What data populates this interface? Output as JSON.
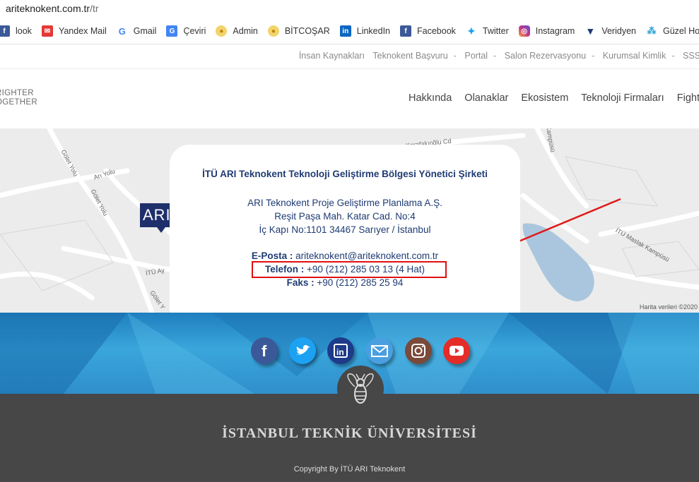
{
  "browser": {
    "url_host": "ariteknokent.com.tr",
    "url_path": "/tr",
    "bookmarks": [
      {
        "label": "look",
        "icon": "facebook-icon",
        "color": "#3b5998"
      },
      {
        "label": "Yandex Mail",
        "icon": "yandex-mail-icon",
        "color": "#e53935"
      },
      {
        "label": "Gmail",
        "icon": "google-icon",
        "color": "#4285f4"
      },
      {
        "label": "Çeviri",
        "icon": "translate-icon",
        "color": "#4285f4"
      },
      {
        "label": "Admin",
        "icon": "coin-icon",
        "color": "#e8c34a"
      },
      {
        "label": "BİTCOŞAR",
        "icon": "coin-icon",
        "color": "#e8c34a"
      },
      {
        "label": "LinkedIn",
        "icon": "linkedin-icon",
        "color": "#0a66c2"
      },
      {
        "label": "Facebook",
        "icon": "facebook-icon",
        "color": "#3b5998"
      },
      {
        "label": "Twitter",
        "icon": "twitter-icon",
        "color": "#1da1f2"
      },
      {
        "label": "Instagram",
        "icon": "instagram-icon",
        "color": "#c13584"
      },
      {
        "label": "Veridyen",
        "icon": "veridyen-icon",
        "color": "#1f3b73"
      },
      {
        "label": "Güzel Hosting",
        "icon": "hosting-icon",
        "color": "#29a3d6"
      }
    ]
  },
  "topbar": {
    "links": [
      "İnsan Kaynakları",
      "Teknokent Başvuru",
      "Portal",
      "Salon Rezervasyonu",
      "Kurumsal Kimlik",
      "SSS"
    ],
    "separator": "-"
  },
  "header": {
    "tagline_1": "RIGHTER",
    "tagline_2": "OGETHER",
    "nav": [
      "Hakkında",
      "Olanaklar",
      "Ekosistem",
      "Teknoloji Firmaları",
      "Fight"
    ]
  },
  "map": {
    "labels": [
      "Gölet Yolu",
      "Arı Yolu",
      "Gölet Yolu",
      "İTÜ Ay",
      "Gölet Y",
      "Kerafakıoğlu Cd",
      "Kampüsü",
      "İTÜ Maslak Kampüsü"
    ],
    "marker_text": "ARI",
    "copyright": "Harita verileri ©2020"
  },
  "contact": {
    "company": "İTÜ ARI Teknokent Teknoloji Geliştirme Bölgesi Yönetici Şirketi",
    "address_1": "ARI Teknokent Proje Geliştirme Planlama A.Ş.",
    "address_2": "Reşit Paşa Mah. Katar Cad. No:4",
    "address_3": "İç Kapı No:1101 34467 Sarıyer / İstanbul",
    "email_label": "E-Posta :",
    "email": "ariteknokent@ariteknokent.com.tr",
    "phone_label": "Telefon :",
    "phone": "+90 (212) 285 03 13 (4 Hat)",
    "fax_label": "Faks :",
    "fax": "+90 (212) 285 25 94"
  },
  "social": [
    {
      "name": "facebook-icon",
      "color": "#3b5998"
    },
    {
      "name": "twitter-icon",
      "color": "#1da1f2"
    },
    {
      "name": "linkedin-icon",
      "color": "#1e3a8a"
    },
    {
      "name": "email-icon",
      "color": "#4a9fe0"
    },
    {
      "name": "instagram-icon",
      "color": "#7a4a3a"
    },
    {
      "name": "youtube-icon",
      "color": "#e52d27"
    }
  ],
  "footer": {
    "university": "İSTANBUL TEKNİK ÜNİVERSİTESİ",
    "copyright": "Copyright By İTÜ ARI Teknokent"
  }
}
